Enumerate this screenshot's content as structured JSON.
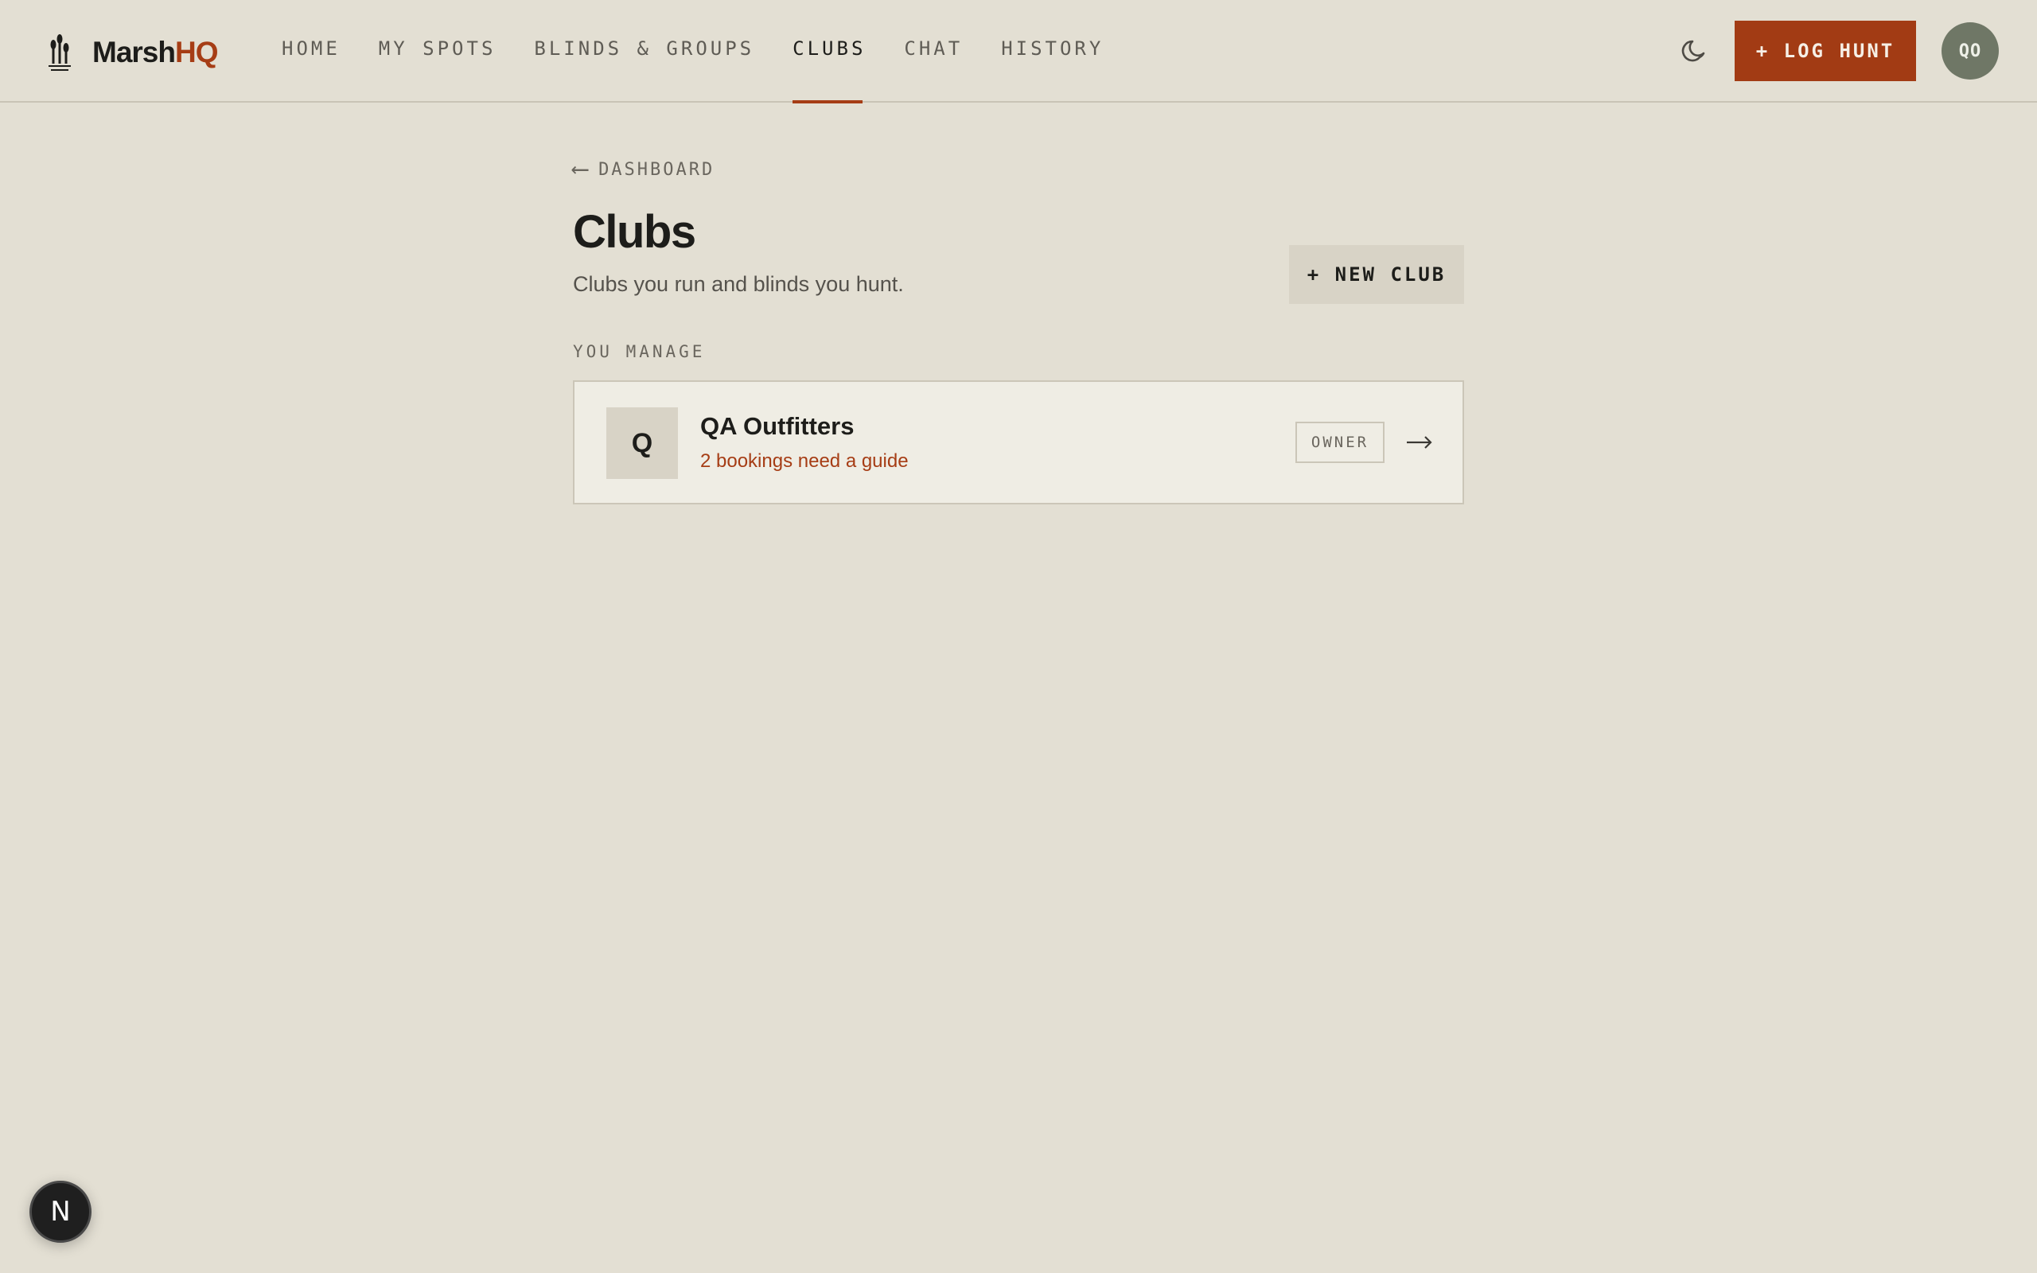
{
  "brand": {
    "name_primary": "Marsh",
    "name_accent": "HQ",
    "icon": "reeds-icon"
  },
  "nav": {
    "items": [
      {
        "label": "HOME",
        "active": false
      },
      {
        "label": "MY SPOTS",
        "active": false
      },
      {
        "label": "BLINDS & GROUPS",
        "active": false
      },
      {
        "label": "CLUBS",
        "active": true
      },
      {
        "label": "CHAT",
        "active": false
      },
      {
        "label": "HISTORY",
        "active": false
      }
    ]
  },
  "header": {
    "theme_icon": "moon-icon",
    "log_hunt_label": "+ LOG HUNT",
    "avatar_initials": "QO"
  },
  "breadcrumb": {
    "arrow": "⟵",
    "label": "DASHBOARD"
  },
  "page": {
    "title": "Clubs",
    "subtitle": "Clubs you run and blinds you hunt.",
    "new_club_label": "+ NEW CLUB",
    "section_label": "YOU MANAGE"
  },
  "clubs": [
    {
      "initial": "Q",
      "name": "QA Outfitters",
      "status": "2 bookings need a guide",
      "role": "OWNER"
    }
  ],
  "dev_badge": {
    "label": "N"
  },
  "colors": {
    "background": "#e3dfd3",
    "accent": "#a23b14",
    "avatar": "#6f7766",
    "card": "#efede4"
  }
}
